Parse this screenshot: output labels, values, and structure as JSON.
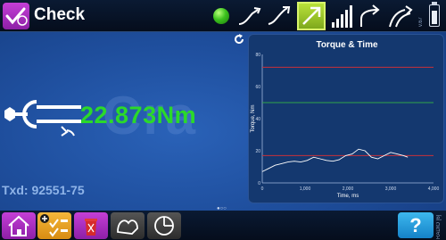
{
  "header": {
    "title": "Check",
    "version": "v.67"
  },
  "main": {
    "torque_value": "22.873Nm",
    "txd_label": "Txd: 92551-75",
    "watermark": "Cra",
    "pager": "●○○"
  },
  "footer": {
    "help_label": "?",
    "radio_label": "RADIO [6]"
  },
  "colors": {
    "accent_green": "#2bd92a",
    "limit_red": "#c8303a",
    "target_green": "#2fa54a",
    "curve_white": "#ffffff"
  },
  "chart_data": {
    "type": "line",
    "title": "Torque & Time",
    "xlabel": "Time, ms",
    "ylabel": "Torque, Nm",
    "xlim": [
      0,
      4000
    ],
    "ylim": [
      0,
      80
    ],
    "x_ticks": [
      "0",
      "1,000",
      "2,000",
      "3,000",
      "4,000"
    ],
    "y_ticks": [
      "0",
      "20",
      "40",
      "60",
      "80"
    ],
    "reference_lines": [
      {
        "y": 72,
        "color": "#c8303a"
      },
      {
        "y": 50,
        "color": "#2fa54a"
      },
      {
        "y": 17,
        "color": "#c8303a"
      }
    ],
    "series": [
      {
        "x": [
          0,
          150,
          300,
          450,
          600,
          750,
          900,
          1050,
          1200,
          1350,
          1500,
          1650,
          1800,
          1950,
          2100,
          2250,
          2400,
          2550,
          2700,
          2850,
          3000,
          3150,
          3300,
          3400
        ],
        "values": [
          7,
          9,
          11,
          12,
          13,
          13.5,
          13,
          14,
          16,
          15,
          14,
          13.5,
          14.5,
          17,
          18,
          21,
          20,
          16,
          15,
          17,
          19,
          18,
          17,
          16
        ]
      }
    ]
  }
}
